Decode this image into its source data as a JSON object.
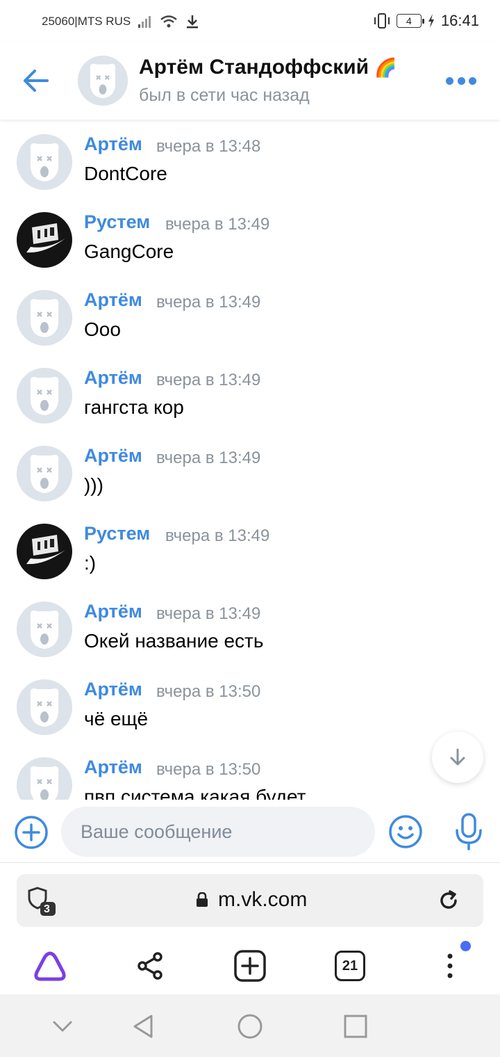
{
  "status_bar": {
    "carrier": "25060|MTS RUS",
    "battery": "4",
    "time": "16:41"
  },
  "chat_header": {
    "name": "Артём Стандоффский",
    "name_emoji": "🌈",
    "status": "был в сети час назад"
  },
  "messages": [
    {
      "author": "Артём",
      "time": "вчера в 13:48",
      "text": "DontCore",
      "avatar": "default"
    },
    {
      "author": "Рустем",
      "time": "вчера в 13:49",
      "text": "GangCore",
      "avatar": "photo"
    },
    {
      "author": "Артём",
      "time": "вчера в 13:49",
      "text": "Ооо",
      "avatar": "default"
    },
    {
      "author": "Артём",
      "time": "вчера в 13:49",
      "text": "гангста кор",
      "avatar": "default"
    },
    {
      "author": "Артём",
      "time": "вчера в 13:49",
      "text": ")))",
      "avatar": "default"
    },
    {
      "author": "Рустем",
      "time": "вчера в 13:49",
      "text": ":)",
      "avatar": "photo"
    },
    {
      "author": "Артём",
      "time": "вчера в 13:49",
      "text": "Окей название есть",
      "avatar": "default"
    },
    {
      "author": "Артём",
      "time": "вчера в 13:50",
      "text": "чё ещё",
      "avatar": "default"
    },
    {
      "author": "Артём",
      "time": "вчера в 13:50",
      "text": "пвп система какая будет",
      "avatar": "default"
    }
  ],
  "composer": {
    "placeholder": "Ваше сообщение"
  },
  "browser": {
    "url": "m.vk.com",
    "shield_count": "3",
    "tabs_count": "21"
  },
  "colors": {
    "accent": "#3f8ae0",
    "muted": "#8a939c",
    "alice": "#7b3fe4"
  }
}
